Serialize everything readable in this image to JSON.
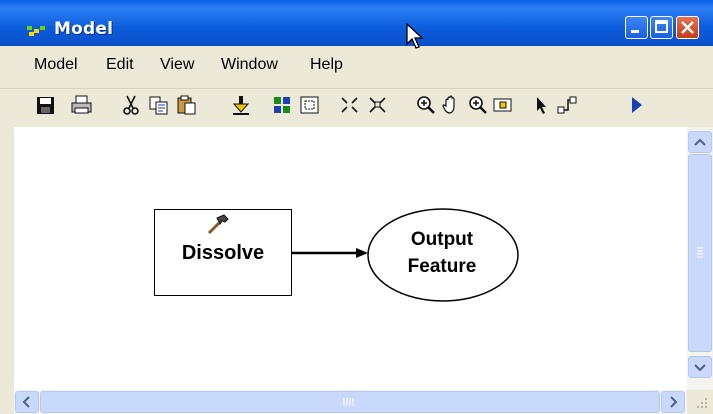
{
  "window": {
    "title": "Model",
    "colors": {
      "titlebar": "#0a5fe8",
      "close_button": "#c63a17",
      "face": "#ece9d8",
      "canvas": "#ffffff"
    }
  },
  "menubar": {
    "items": [
      "Model",
      "Edit",
      "View",
      "Window",
      "Help"
    ]
  },
  "toolbar": {
    "buttons": [
      "save-icon",
      "print-icon",
      "cut-icon",
      "copy-icon",
      "paste-icon",
      "add-data-icon",
      "grid-icon",
      "full-extent-icon",
      "zoom-in-fixed-icon",
      "zoom-out-fixed-icon",
      "zoom-in-icon",
      "pan-icon",
      "zoom-out-icon",
      "overview-icon",
      "select-icon",
      "connect-icon",
      "run-icon"
    ]
  },
  "diagram": {
    "tool": {
      "label": "Dissolve",
      "icon": "hammer-icon"
    },
    "output": {
      "line1": "Output",
      "line2": "Feature"
    }
  }
}
